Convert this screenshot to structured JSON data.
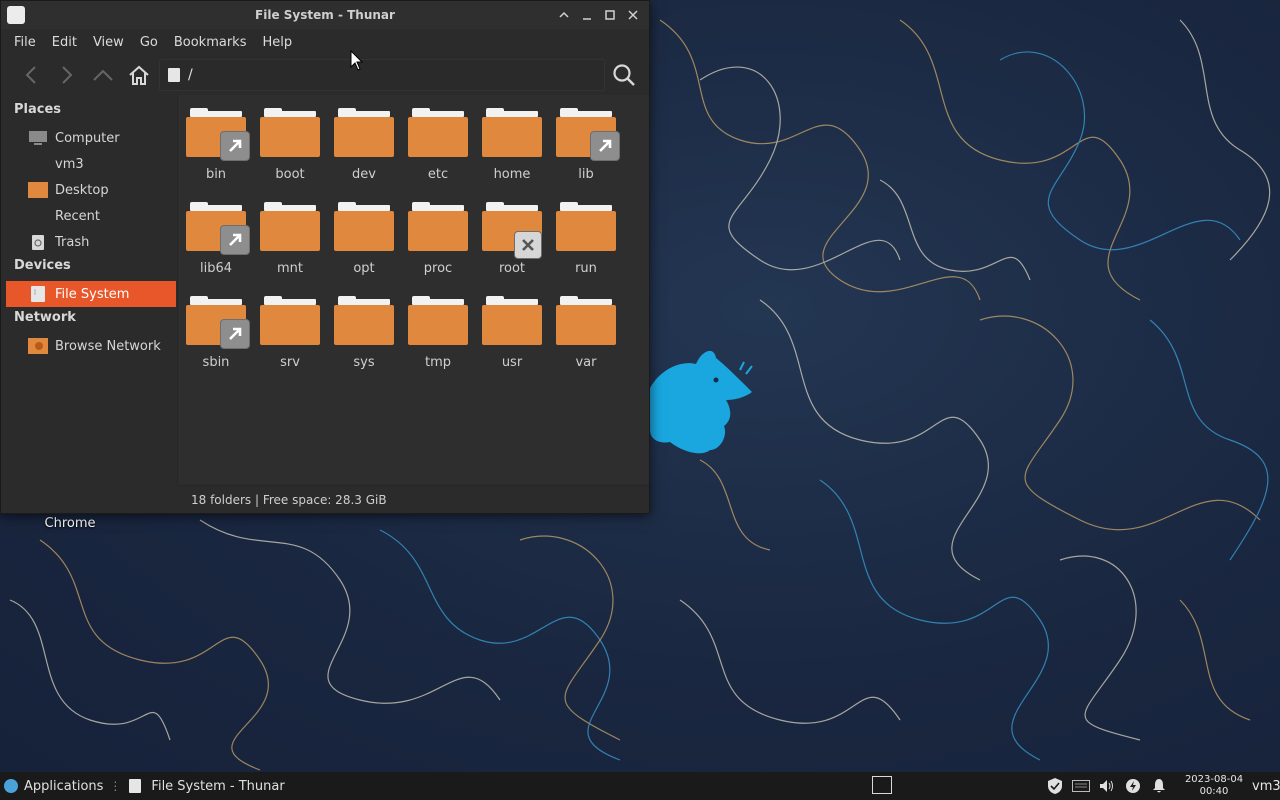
{
  "desktop": {
    "icon_label": "Chrome"
  },
  "window": {
    "title": "File System - Thunar",
    "menu": [
      "File",
      "Edit",
      "View",
      "Go",
      "Bookmarks",
      "Help"
    ],
    "location_path": "/",
    "sidebar": {
      "places_title": "Places",
      "places": [
        "Computer",
        "vm3",
        "Desktop",
        "Recent",
        "Trash"
      ],
      "devices_title": "Devices",
      "devices": [
        "File System"
      ],
      "network_title": "Network",
      "network": [
        "Browse Network"
      ]
    },
    "folders": [
      {
        "name": "bin",
        "badge": "link"
      },
      {
        "name": "boot",
        "badge": ""
      },
      {
        "name": "dev",
        "badge": ""
      },
      {
        "name": "etc",
        "badge": ""
      },
      {
        "name": "home",
        "badge": ""
      },
      {
        "name": "lib",
        "badge": "link"
      },
      {
        "name": "lib64",
        "badge": "link"
      },
      {
        "name": "mnt",
        "badge": ""
      },
      {
        "name": "opt",
        "badge": ""
      },
      {
        "name": "proc",
        "badge": ""
      },
      {
        "name": "root",
        "badge": "locked"
      },
      {
        "name": "run",
        "badge": ""
      },
      {
        "name": "sbin",
        "badge": "link"
      },
      {
        "name": "srv",
        "badge": ""
      },
      {
        "name": "sys",
        "badge": ""
      },
      {
        "name": "tmp",
        "badge": ""
      },
      {
        "name": "usr",
        "badge": ""
      },
      {
        "name": "var",
        "badge": ""
      }
    ],
    "status": "18 folders  |  Free space: 28.3 GiB"
  },
  "taskbar": {
    "applications_label": "Applications",
    "task_label": "File System - Thunar",
    "clock_date": "2023-08-04",
    "clock_time": "00:40",
    "user": "vm3"
  },
  "colors": {
    "accent": "#e8572a",
    "folder": "#e0893e",
    "wallpaper": "#1a2740"
  }
}
